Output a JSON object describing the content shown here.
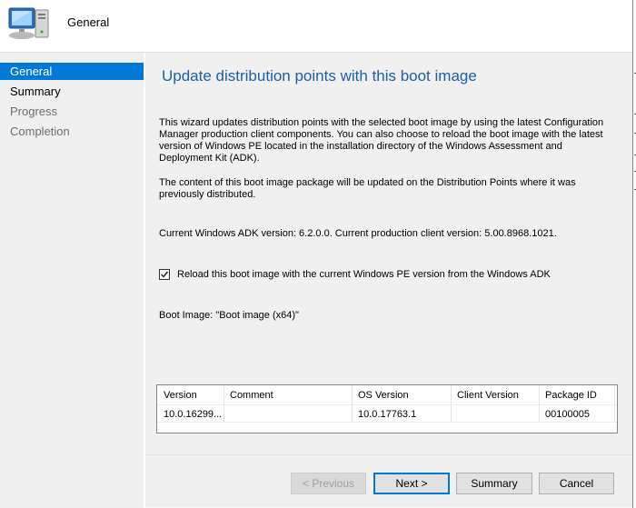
{
  "header": {
    "title": "General",
    "icon": "computer-monitor-icon"
  },
  "nav": {
    "items": [
      {
        "label": "General",
        "state": "active"
      },
      {
        "label": "Summary",
        "state": "normal"
      },
      {
        "label": "Progress",
        "state": "disabled"
      },
      {
        "label": "Completion",
        "state": "disabled"
      }
    ]
  },
  "main": {
    "heading": "Update distribution points with this boot image",
    "intro": "This wizard updates distribution points with the selected boot image by using the latest Configuration Manager production client components. You can also choose to reload the boot image with the latest version of Windows PE located in the installation directory of the Windows Assessment and Deployment Kit (ADK).",
    "content_note": "The content of this boot image package will be updated on the Distribution Points where it was previously distributed.",
    "adk_line": "Current Windows ADK version: 6.2.0.0. Current production client version: 5.00.8968.1021.",
    "reload_checkbox": {
      "label": "Reload this boot image with the current Windows PE version from the Windows ADK",
      "checked": true
    },
    "boot_image_line": "Boot Image: \"Boot image (x64)\""
  },
  "table": {
    "columns": [
      "Version",
      "Comment",
      "OS Version",
      "Client Version",
      "Package ID"
    ],
    "rows": [
      {
        "version": "10.0.16299...",
        "comment": "",
        "os_version": "10.0.17763.1",
        "client_version": "",
        "package_id": "00100005"
      }
    ]
  },
  "buttons": {
    "previous": "< Previous",
    "next": "Next >",
    "summary": "Summary",
    "cancel": "Cancel"
  },
  "colors": {
    "accent": "#0078d7",
    "heading": "#1e5fa8",
    "panel": "#f0f0f0"
  }
}
